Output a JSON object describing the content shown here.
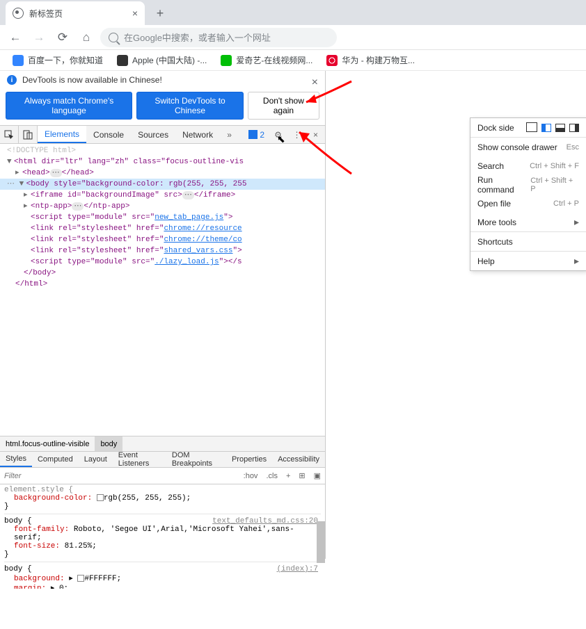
{
  "tab": {
    "title": "新标签页"
  },
  "omnibox": {
    "placeholder": "在Google中搜索，或者输入一个网址"
  },
  "bookmarks": [
    {
      "label": "百度一下，你就知道",
      "icon": "baidu"
    },
    {
      "label": "Apple (中国大陆) -...",
      "icon": "apple"
    },
    {
      "label": "爱奇艺-在线视频网...",
      "icon": "iqiyi"
    },
    {
      "label": "华为 - 构建万物互...",
      "icon": "huawei"
    }
  ],
  "banner": {
    "msg": "DevTools is now available in Chinese!",
    "btn_match": "Always match Chrome's language",
    "btn_switch": "Switch DevTools to Chinese",
    "btn_dont": "Don't show again"
  },
  "tabs": {
    "elements": "Elements",
    "console": "Console",
    "sources": "Sources",
    "network": "Network",
    "issues": "2"
  },
  "menu": {
    "dock": "Dock side",
    "console_drawer": "Show console drawer",
    "console_sc": "Esc",
    "search": "Search",
    "search_sc": "Ctrl + Shift + F",
    "run": "Run command",
    "run_sc": "Ctrl + Shift + P",
    "open": "Open file",
    "open_sc": "Ctrl + P",
    "more": "More tools",
    "shortcuts": "Shortcuts",
    "help": "Help"
  },
  "dom": {
    "doctype": "<!DOCTYPE html>",
    "html_open": "<html dir=\"ltr\" lang=\"zh\" class=\"focus-outline-vis",
    "head": "<head>",
    "head_close": "</head>",
    "body_open": "<body style=\"background-color: rgb(255, 255, 255",
    "iframe": "<iframe id=\"backgroundImage\" src>",
    "iframe_close": "</iframe>",
    "ntp": "<ntp-app>",
    "ntp_close": "</ntp-app>",
    "script1": "<script type=\"module\" src=\"",
    "script1_link": "new_tab_page.js",
    "script1_end": "\">",
    "link1": "<link rel=\"stylesheet\" href=\"",
    "link1_link": "chrome://resource",
    "link2": "<link rel=\"stylesheet\" href=\"",
    "link2_link": "chrome://theme/co",
    "link3": "<link rel=\"stylesheet\" href=\"",
    "link3_link": "shared_vars.css",
    "link3_end": "\">",
    "script2": "<script type=\"module\" src=\"",
    "script2_link": "./lazy_load.js",
    "script2_end": "\"></s",
    "body_close": "</body>",
    "html_close": "</html>"
  },
  "crumbs": {
    "c1": "html.focus-outline-visible",
    "c2": "body"
  },
  "stabs": {
    "styles": "Styles",
    "computed": "Computed",
    "layout": "Layout",
    "events": "Event Listeners",
    "dom": "DOM Breakpoints",
    "props": "Properties",
    "acc": "Accessibility"
  },
  "filter": {
    "placeholder": "Filter",
    "hov": ":hov",
    "cls": ".cls"
  },
  "rules": {
    "r1_sel": "element.style {",
    "r1_p": "background-color:",
    "r1_v": "rgb(255, 255, 255);",
    "r2_src": "text_defaults_md.css:20",
    "r2_sel": "body {",
    "r2_p1": "font-family:",
    "r2_v1": " Roboto, 'Segoe UI',Arial,'Microsoft Yahei',sans-serif;",
    "r2_p2": "font-size:",
    "r2_v2": " 81.25%;",
    "r3_src": "(index):7",
    "r3_sel": "body {",
    "r3_p1": "background:",
    "r3_v1": "#FFFFFF;",
    "r3_p2": "margin:",
    "r3_v2": " 0;",
    "close": "}"
  }
}
